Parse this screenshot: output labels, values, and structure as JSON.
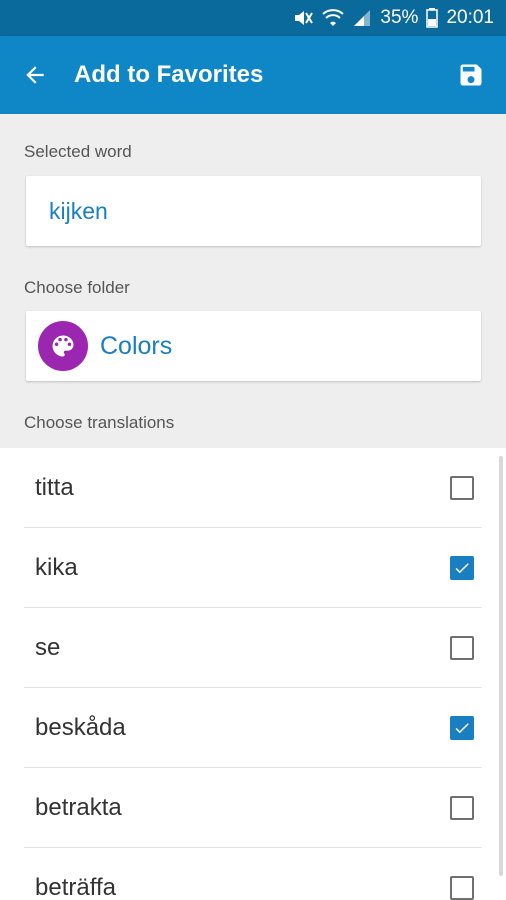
{
  "status_bar": {
    "battery": "35%",
    "time": "20:01",
    "icons": [
      "mute-icon",
      "wifi-icon",
      "signal-icon",
      "battery-icon"
    ]
  },
  "app_bar": {
    "title": "Add to Favorites",
    "back_icon": "arrow-back-icon",
    "save_icon": "save-icon",
    "color": "#0f87c7"
  },
  "selected_word": {
    "label": "Selected word",
    "value": "kijken"
  },
  "folder": {
    "label": "Choose folder",
    "name": "Colors",
    "icon": "palette-icon",
    "icon_color": "#9b27b0"
  },
  "translations": {
    "label": "Choose translations",
    "items": [
      {
        "text": "titta",
        "checked": false
      },
      {
        "text": "kika",
        "checked": true
      },
      {
        "text": "se",
        "checked": false
      },
      {
        "text": "beskåda",
        "checked": true
      },
      {
        "text": "betrakta",
        "checked": false
      },
      {
        "text": "beträffa",
        "checked": false
      }
    ]
  }
}
